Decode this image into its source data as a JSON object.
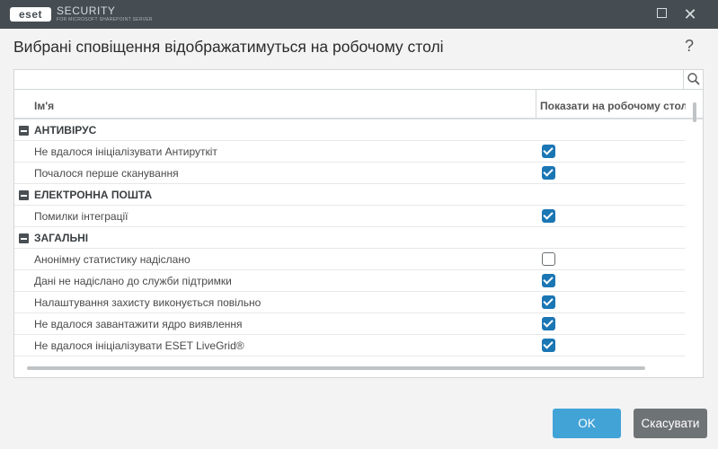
{
  "window": {
    "logo": "eset",
    "brand_title": "SECURITY",
    "brand_subtitle": "FOR MICROSOFT SHAREPOINT SERVER",
    "close_icon": "✕"
  },
  "dialog": {
    "heading": "Вибрані сповіщення відображатимуться на робочому столі",
    "help": "?"
  },
  "search": {
    "value": ""
  },
  "table": {
    "col_name": "Ім'я",
    "col_show": "Показати на робочому столі",
    "groups": [
      {
        "label": "АНТИВІРУС",
        "items": [
          {
            "label": "Не вдалося ініціалізувати Антируткіт",
            "checked": true
          },
          {
            "label": "Почалося перше сканування",
            "checked": true
          }
        ]
      },
      {
        "label": "ЕЛЕКТРОННА ПОШТА",
        "items": [
          {
            "label": "Помилки інтеграції",
            "checked": true
          }
        ]
      },
      {
        "label": "ЗАГАЛЬНІ",
        "items": [
          {
            "label": "Анонімну статистику надіслано",
            "checked": false
          },
          {
            "label": "Дані не надіслано до служби підтримки",
            "checked": true
          },
          {
            "label": "Налаштування захисту виконується повільно",
            "checked": true
          },
          {
            "label": "Не вдалося завантажити ядро виявлення",
            "checked": true
          },
          {
            "label": "Не вдалося ініціалізувати ESET LiveGrid®",
            "checked": true
          }
        ]
      }
    ]
  },
  "buttons": {
    "ok": "OK",
    "cancel": "Скасувати"
  },
  "colors": {
    "accent": "#42a3d7",
    "checkbox": "#1b76b4",
    "titlebar": "#454d52"
  }
}
